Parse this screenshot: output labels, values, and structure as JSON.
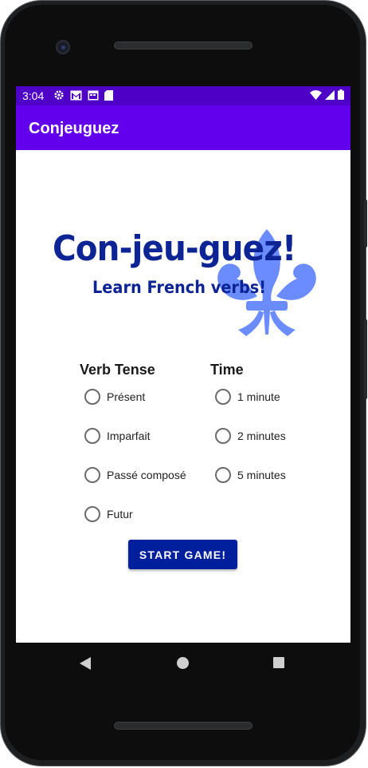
{
  "status_bar": {
    "time": "3:04",
    "left_icons": [
      "gear-icon",
      "gmail-icon",
      "calendar-icon",
      "sd-card-icon"
    ],
    "right_icons": [
      "wifi-icon",
      "signal-icon",
      "battery-icon"
    ]
  },
  "app_bar": {
    "title": "Conjeuguez"
  },
  "logo": {
    "title": "Con-jeu-guez!",
    "subtitle": "Learn French verbs!",
    "emblem": "fleur-de-lis-icon",
    "title_color": "#0d2494",
    "emblem_color": "#6a8cff"
  },
  "verb_tense": {
    "heading": "Verb Tense",
    "options": [
      "Présent",
      "Imparfait",
      "Passé composé",
      "Futur"
    ]
  },
  "time": {
    "heading": "Time",
    "options": [
      "1 minute",
      "2 minutes",
      "5 minutes"
    ]
  },
  "start_button": {
    "label": "START GAME!"
  },
  "nav_bar": {
    "icons": [
      "back-icon",
      "home-icon",
      "recents-icon"
    ]
  },
  "colors": {
    "status_bar": "#4f00c7",
    "app_bar": "#6200ee",
    "button": "#001f9c"
  }
}
